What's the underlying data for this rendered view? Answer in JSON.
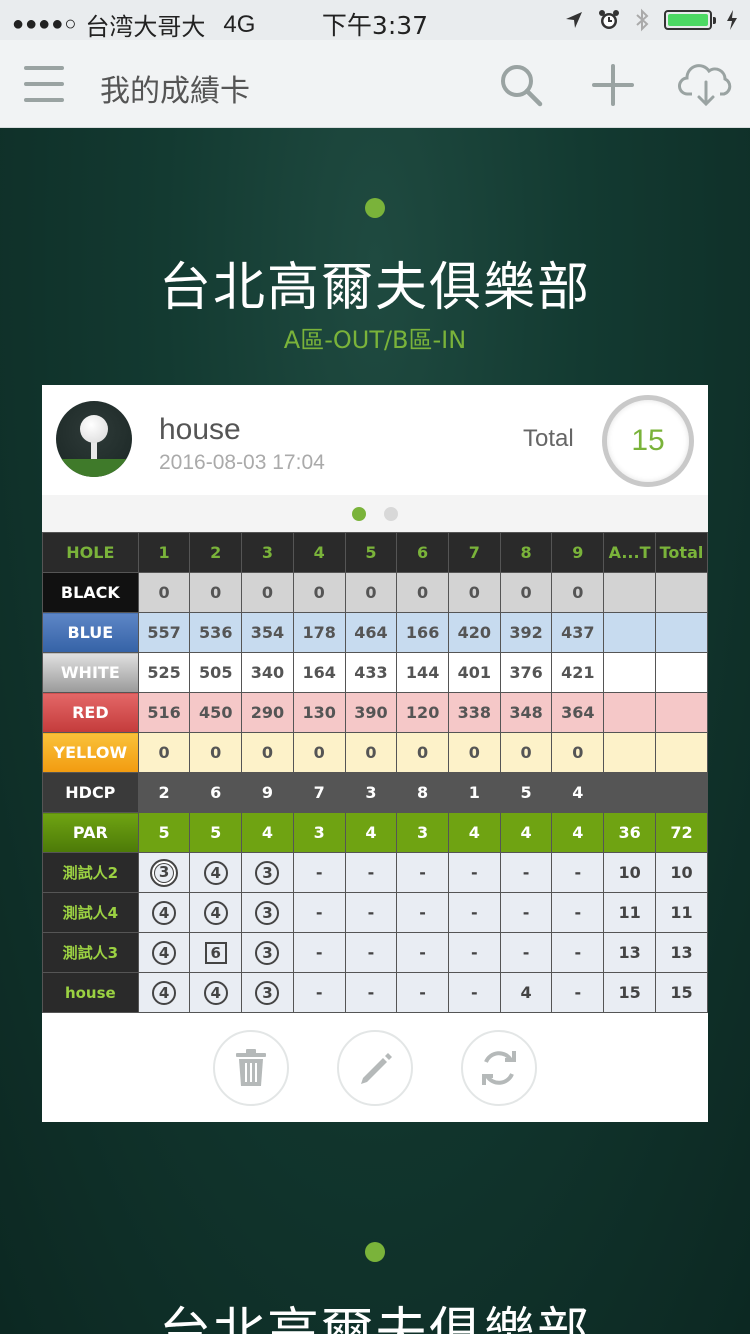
{
  "status_bar": {
    "signal_dots": "●●●●○",
    "carrier": "台湾大哥大",
    "network": "4G",
    "time": "下午3:37"
  },
  "nav": {
    "title": "我的成績卡",
    "icons": [
      "menu-icon",
      "search-icon",
      "add-icon",
      "cloud-download-icon"
    ]
  },
  "course": {
    "name": "台北高爾夫俱樂部",
    "route": "A區-OUT/B區-IN"
  },
  "card": {
    "player": "house",
    "datetime": "2016-08-03 17:04",
    "total_label": "Total",
    "total_value": "15"
  },
  "table": {
    "header": [
      "HOLE",
      "1",
      "2",
      "3",
      "4",
      "5",
      "6",
      "7",
      "8",
      "9",
      "A...T",
      "Total"
    ],
    "rows": [
      {
        "key": "black",
        "label": "BLACK",
        "cells": [
          "0",
          "0",
          "0",
          "0",
          "0",
          "0",
          "0",
          "0",
          "0",
          "",
          ""
        ]
      },
      {
        "key": "blue",
        "label": "BLUE",
        "cells": [
          "557",
          "536",
          "354",
          "178",
          "464",
          "166",
          "420",
          "392",
          "437",
          "",
          ""
        ]
      },
      {
        "key": "white",
        "label": "WHITE",
        "cells": [
          "525",
          "505",
          "340",
          "164",
          "433",
          "144",
          "401",
          "376",
          "421",
          "",
          ""
        ]
      },
      {
        "key": "red",
        "label": "RED",
        "cells": [
          "516",
          "450",
          "290",
          "130",
          "390",
          "120",
          "338",
          "348",
          "364",
          "",
          ""
        ]
      },
      {
        "key": "yellow",
        "label": "YELLOW",
        "cells": [
          "0",
          "0",
          "0",
          "0",
          "0",
          "0",
          "0",
          "0",
          "0",
          "",
          ""
        ]
      },
      {
        "key": "hdcp",
        "label": "HDCP",
        "cells": [
          "2",
          "6",
          "9",
          "7",
          "3",
          "8",
          "1",
          "5",
          "4",
          "",
          ""
        ]
      },
      {
        "key": "par",
        "label": "PAR",
        "cells": [
          "5",
          "5",
          "4",
          "3",
          "4",
          "3",
          "4",
          "4",
          "4",
          "36",
          "72"
        ]
      }
    ],
    "players": [
      {
        "label": "測試人2",
        "scores": [
          "3",
          "4",
          "3",
          "-",
          "-",
          "-",
          "-",
          "-",
          "-"
        ],
        "marks": [
          "double-circle",
          "circle",
          "circle",
          "",
          "",
          "",
          "",
          "",
          ""
        ],
        "out": "10",
        "total": "10"
      },
      {
        "label": "測試人4",
        "scores": [
          "4",
          "4",
          "3",
          "-",
          "-",
          "-",
          "-",
          "-",
          "-"
        ],
        "marks": [
          "circle",
          "circle",
          "circle",
          "",
          "",
          "",
          "",
          "",
          ""
        ],
        "out": "11",
        "total": "11"
      },
      {
        "label": "測試人3",
        "scores": [
          "4",
          "6",
          "3",
          "-",
          "-",
          "-",
          "-",
          "-",
          "-"
        ],
        "marks": [
          "circle",
          "square",
          "circle",
          "",
          "",
          "",
          "",
          "",
          ""
        ],
        "out": "13",
        "total": "13"
      },
      {
        "label": "house",
        "scores": [
          "4",
          "4",
          "3",
          "-",
          "-",
          "-",
          "-",
          "4",
          "-"
        ],
        "marks": [
          "circle",
          "circle",
          "circle",
          "",
          "",
          "",
          "",
          "",
          ""
        ],
        "out": "15",
        "total": "15"
      }
    ]
  },
  "actions": [
    "trash-icon",
    "edit-icon",
    "refresh-icon"
  ],
  "colors": {
    "accent_green": "#7ab33a",
    "par_green": "#6fa312",
    "blue_tee": "#3562a6",
    "red_tee": "#c43b3b",
    "yellow_tee": "#f29b10",
    "background": "#133a31"
  }
}
